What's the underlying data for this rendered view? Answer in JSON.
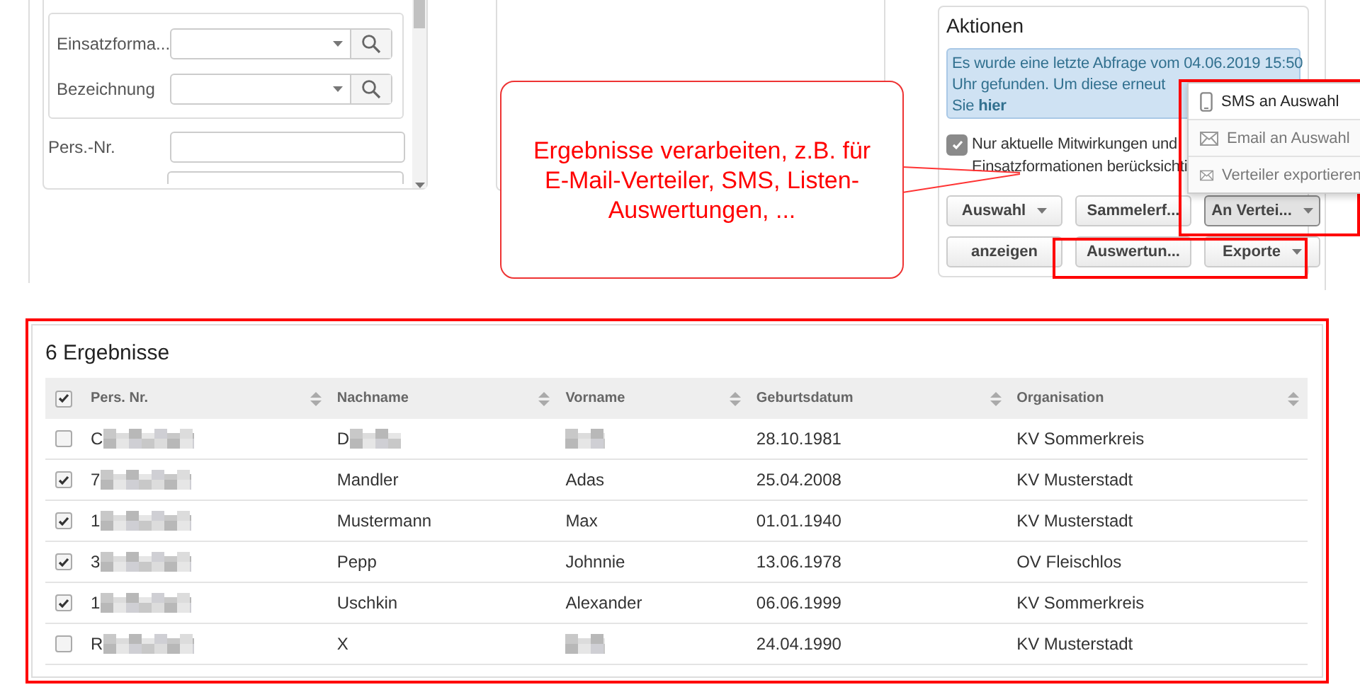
{
  "search_form": {
    "fields": [
      {
        "label": "Einsatzforma...",
        "kind": "combo"
      },
      {
        "label": "Bezeichnung",
        "kind": "combo"
      },
      {
        "label": "Pers.-Nr.",
        "kind": "text"
      }
    ]
  },
  "actions": {
    "title": "Aktionen",
    "info": {
      "lines": [
        "Es wurde eine letzte Abfrage vom 04.06.2019 15:50",
        "Uhr gefunden. Um diese erneut",
        "Sie"
      ],
      "link": "hier"
    },
    "checkbox": {
      "lines": [
        "Nur aktuelle Mitwirkungen und",
        "Einsatzformationen berücksichti"
      ],
      "checked": true
    },
    "buttons": [
      {
        "label": "Auswahl",
        "dropdown": true,
        "expanded": false
      },
      {
        "label": "Sammelerf...",
        "dropdown": false,
        "expanded": false
      },
      {
        "label": "An Vertei...",
        "dropdown": true,
        "expanded": true
      },
      {
        "label": "anzeigen",
        "dropdown": false,
        "expanded": false
      },
      {
        "label": "Auswertun...",
        "dropdown": false,
        "expanded": false
      },
      {
        "label": "Exporte",
        "dropdown": true,
        "expanded": false
      }
    ],
    "menu": [
      {
        "label": "SMS an Auswahl",
        "kind": "phone",
        "selected": true
      },
      {
        "label": "Email an Auswahl",
        "kind": "mail",
        "selected": false
      },
      {
        "label": "Verteiler exportieren",
        "kind": "mail",
        "selected": false
      }
    ]
  },
  "annotation": {
    "text": "Ergebnisse verarbeiten, z.B. für E-Mail-Verteiler, SMS, Listen-Auswertungen, ..."
  },
  "results": {
    "title": "6 Ergebnisse",
    "all_checked": true,
    "columns": [
      "Pers. Nr.",
      "Nachname",
      "Vorname",
      "Geburtsdatum",
      "Organisation"
    ],
    "rows": [
      {
        "checked": false,
        "cells": [
          {
            "kind": "redacted",
            "text": "C"
          },
          {
            "kind": "redacted",
            "text": "D"
          },
          {
            "kind": "redacted"
          },
          {
            "kind": "text",
            "text": "28.10.1981"
          },
          {
            "kind": "text",
            "text": "KV Sommerkreis"
          }
        ]
      },
      {
        "checked": true,
        "cells": [
          {
            "kind": "redacted",
            "text": "7"
          },
          {
            "kind": "text",
            "text": "Mandler"
          },
          {
            "kind": "text",
            "text": "Adas"
          },
          {
            "kind": "text",
            "text": "25.04.2008"
          },
          {
            "kind": "text",
            "text": "KV Musterstadt"
          }
        ]
      },
      {
        "checked": true,
        "cells": [
          {
            "kind": "redacted",
            "text": "1"
          },
          {
            "kind": "text",
            "text": "Mustermann"
          },
          {
            "kind": "text",
            "text": "Max"
          },
          {
            "kind": "text",
            "text": "01.01.1940"
          },
          {
            "kind": "text",
            "text": "KV Musterstadt"
          }
        ]
      },
      {
        "checked": true,
        "cells": [
          {
            "kind": "redacted",
            "text": "3"
          },
          {
            "kind": "text",
            "text": "Pepp"
          },
          {
            "kind": "text",
            "text": "Johnnie"
          },
          {
            "kind": "text",
            "text": "13.06.1978"
          },
          {
            "kind": "text",
            "text": "OV Fleischlos"
          }
        ]
      },
      {
        "checked": true,
        "cells": [
          {
            "kind": "redacted",
            "text": "1"
          },
          {
            "kind": "text",
            "text": "Uschkin"
          },
          {
            "kind": "text",
            "text": "Alexander"
          },
          {
            "kind": "text",
            "text": "06.06.1999"
          },
          {
            "kind": "text",
            "text": "KV Sommerkreis"
          }
        ]
      },
      {
        "checked": false,
        "cells": [
          {
            "kind": "redacted",
            "text": "R"
          },
          {
            "kind": "text",
            "text": "X"
          },
          {
            "kind": "redacted"
          },
          {
            "kind": "text",
            "text": "24.04.1990"
          },
          {
            "kind": "text",
            "text": "KV Musterstadt"
          }
        ]
      }
    ]
  }
}
